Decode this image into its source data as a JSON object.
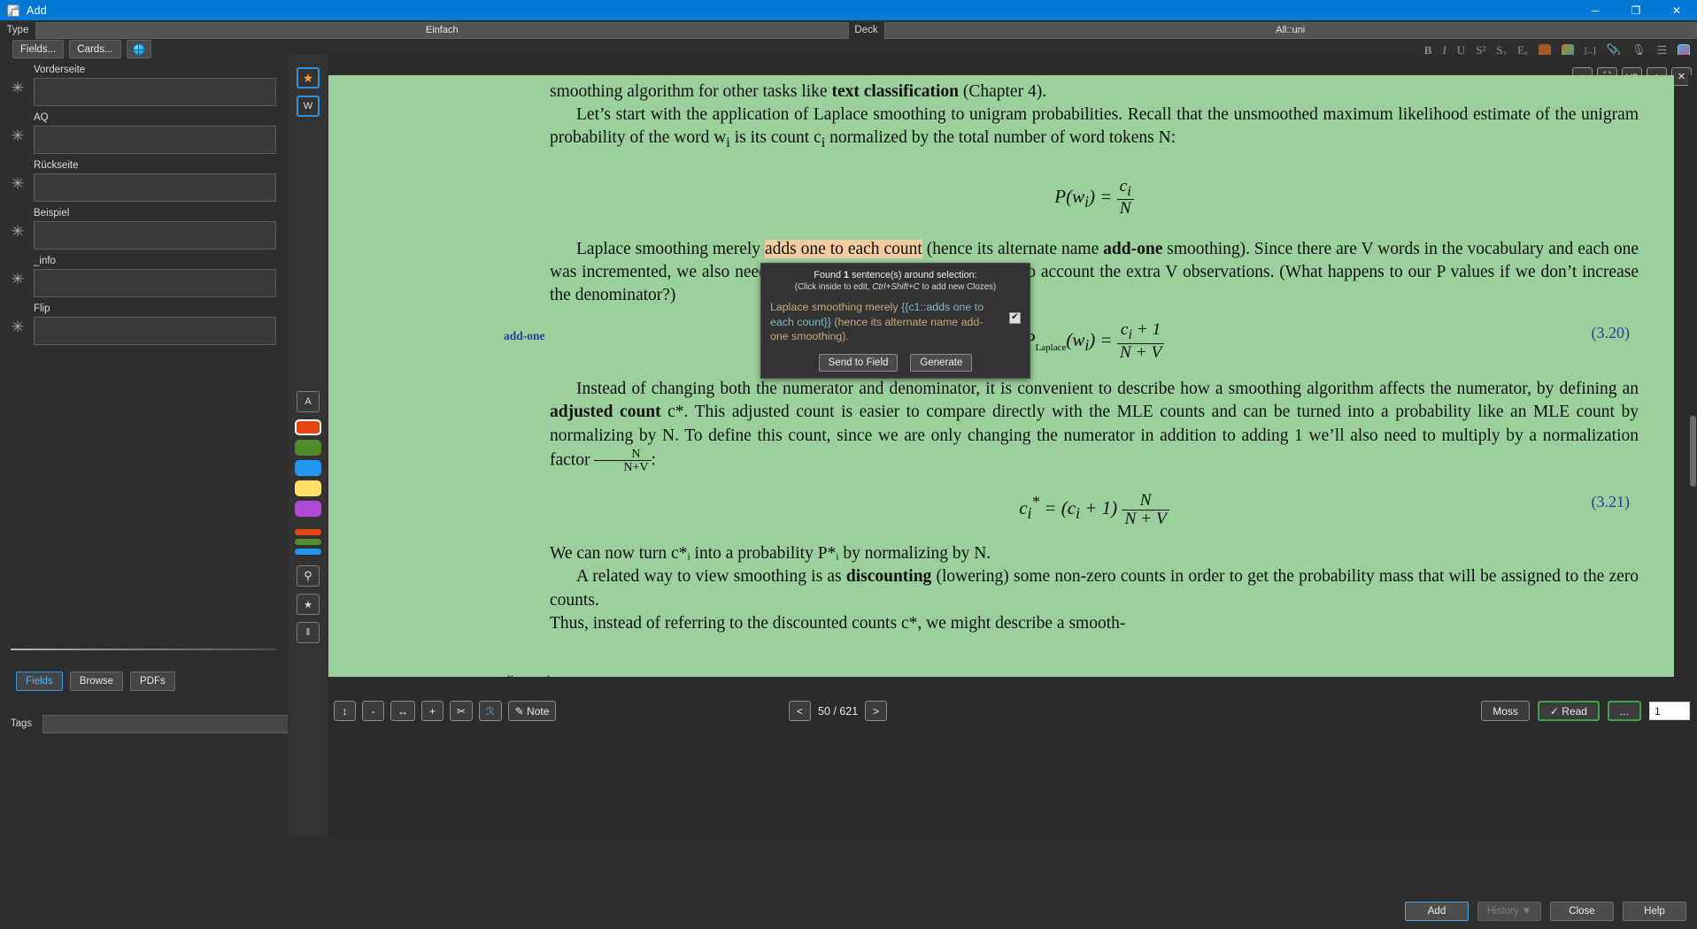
{
  "window": {
    "title": "Add",
    "icon": "add-note-icon",
    "minimize": "─",
    "maximize": "❐",
    "close": "✕"
  },
  "typedeck": {
    "type_label": "Type",
    "type_value": "Einfach",
    "deck_label": "Deck",
    "deck_value": "All::uni"
  },
  "editor_toolbar": {
    "fields_label": "Fields...",
    "cards_label": "Cards...",
    "globe_label": ""
  },
  "rich_toolbar": {
    "bold": "B",
    "italic": "I",
    "underline": "U",
    "superscript": "S²",
    "subscript": "S₂",
    "clear_format": "Eₓ",
    "text_color": "#a8562a",
    "highlight_color": "#8a9a5b",
    "cloze": "[..]",
    "attach": "📎",
    "record": "🎙",
    "more": "☰",
    "image_occlusion": "☰"
  },
  "fields": [
    {
      "label": "Vorderseite",
      "value": "",
      "pin": "✳"
    },
    {
      "label": "AQ",
      "value": "",
      "pin": "✳"
    },
    {
      "label": "Rückseite",
      "value": "",
      "pin": "✳"
    },
    {
      "label": "Beispiel",
      "value": "",
      "pin": "✳"
    },
    {
      "label": "_info",
      "value": "",
      "pin": "✳"
    },
    {
      "label": "Flip",
      "value": "",
      "pin": "✳"
    }
  ],
  "editor_bottom": {
    "fields_tab": "Fields",
    "browse_tab": "Browse",
    "pdfs_tab": "PDFs"
  },
  "tags": {
    "label": "Tags",
    "value": "",
    "placeholder": ""
  },
  "dialog_buttons": {
    "add": "Add",
    "history": "History ▼",
    "close": "Close",
    "help": "Help"
  },
  "pdf_tools": {
    "star_tool": "★",
    "w_tool": "W",
    "text_tool": "A",
    "colors": [
      {
        "name": "orange",
        "hex": "#e8480f",
        "selected": true
      },
      {
        "name": "green",
        "hex": "#4f8a2b",
        "selected": false
      },
      {
        "name": "blue",
        "hex": "#2196f3",
        "selected": false
      },
      {
        "name": "yellow",
        "hex": "#ffe066",
        "selected": false
      },
      {
        "name": "purple",
        "hex": "#b44bd6",
        "selected": false
      }
    ],
    "highlight_lines": [
      {
        "name": "orange-line",
        "hex": "#e8480f"
      },
      {
        "name": "green-line",
        "hex": "#4f8a2b"
      },
      {
        "name": "blue-line",
        "hex": "#2196f3"
      }
    ],
    "search_tool": "⚲",
    "bookmark_tool": "★",
    "columns_tool": "‖"
  },
  "pdf_topbar": [
    {
      "name": "fit-width-button",
      "glyph": "↔"
    },
    {
      "name": "fullscreen-button",
      "glyph": "⛶"
    },
    {
      "name": "split-lr-button",
      "glyph": "L|R"
    },
    {
      "name": "fit-height-button",
      "glyph": "↕"
    },
    {
      "name": "close-pdf-button",
      "glyph": "✕"
    }
  ],
  "pdf_bottom": {
    "resize_vertical": "↕",
    "zoom_out": "-",
    "fit": "↔",
    "zoom_in": "+",
    "cut": "✂",
    "clipboard": "ℛ",
    "note_label": "✎ Note",
    "prev_page": "<",
    "page_indicator": "50 / 621",
    "next_page": ">",
    "moss_label": "Moss",
    "read_label": "✓ Read",
    "more_label": "...",
    "page_input_value": "1"
  },
  "pdf_content": {
    "line1_a": "smoothing algorithm for other tasks like ",
    "line1_b": "text classification",
    "line1_c": " (Chapter 4).",
    "para1": "Let’s start with the application of Laplace smoothing to unigram probabilities. Recall that the unsmoothed maximum likelihood estimate of the unigram probability of the word w",
    "para1_sub1": "i",
    "para1_b": " is its count c",
    "para1_sub2": "i",
    "para1_c": " normalized by the total number of word tokens N:",
    "eq1_lhs": "P(w",
    "eq1_lhs_sub": "i",
    "eq1_lhs_end": ") =",
    "eq1_num": "c",
    "eq1_num_sub": "i",
    "eq1_den": "N",
    "margin_note_1": "add-one",
    "para2_a": "Laplace smoothing merely ",
    "para2_sel": "adds one to each count",
    "para2_b": " (hence its alternate name ",
    "para2_bold": "add-one",
    "para2_c": " smoothing). Since there are V words in the vocabulary and each one was incremented, we also need to adjust the denominator to take into account the extra V observations. (What happens to our P values if we don’t increase the denominator?)",
    "eq2_lhs": "P",
    "eq2_sub": "Laplace",
    "eq2_arg": "(w",
    "eq2_arg_sub": "i",
    "eq2_arg_end": ") =",
    "eq2_num": "c",
    "eq2_num_sub": "i",
    "eq2_num_end": " + 1",
    "eq2_den": "N + V",
    "eq2_number": "(3.20)",
    "para3_a": "Instead of changing both the numerator and denominator, it is convenient to describe how a smoothing algorithm affects the numerator, by defining an ",
    "para3_bold": "adjusted count",
    "para3_b": " c*. This adjusted count is easier to compare directly with the MLE counts and can be turned into a probability like an MLE count by normalizing by N. To define this count, since we are only changing the numerator in addition to adding 1 we’ll also need to multiply by a normalization factor ",
    "para3_frac_top": "N",
    "para3_frac_bot": "N+V",
    "para3_c": ":",
    "eq3_lhs": "c",
    "eq3_lhs_sub": "i",
    "eq3_lhs_star": "*",
    "eq3_eq": " = (c",
    "eq3_sub2": "i",
    "eq3_plus": " + 1)",
    "eq3_frac_top": "N",
    "eq3_frac_bot": "N + V",
    "eq3_number": "(3.21)",
    "para4": "We can now turn c*ᵢ into a probability P*ᵢ by normalizing by N.",
    "margin_note_2": "discounting",
    "para5_a": "A related way to view smoothing is as ",
    "para5_bold": "discounting",
    "para5_b": " (lowering) some non-zero counts in order to get the probability mass that will be assigned to the zero counts.",
    "para6_clipped": "Thus, instead of referring to the discounted counts c*, we might describe a smooth-"
  },
  "popup": {
    "title_a": "Found ",
    "title_count": "1",
    "title_b": " sentence(s) around selection:",
    "subtitle_a": "(Click inside to edit, ",
    "subtitle_shortcut": "Ctrl+Shift+C",
    "subtitle_b": " to add new Clozes)",
    "body_a": "Laplace smoothing merely ",
    "body_cloze": "{{c1::adds one to each count}}",
    "body_b": " (hence its alternate name add- one smoothing).",
    "checkbox": "✔",
    "send_to_field": "Send to Field",
    "generate": "Generate"
  }
}
